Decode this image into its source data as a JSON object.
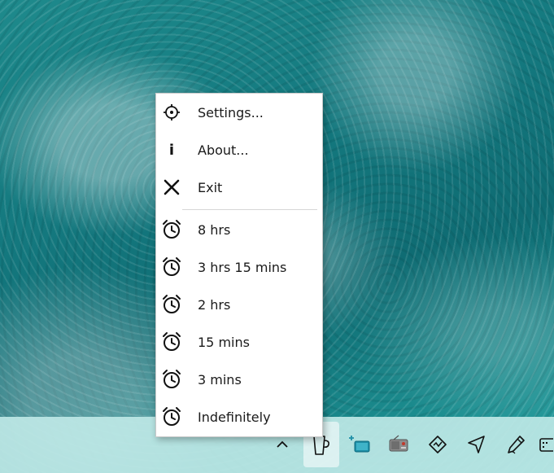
{
  "menu": {
    "items": [
      {
        "label": "Settings...",
        "icon": "gear-icon"
      },
      {
        "label": "About...",
        "icon": "info-icon"
      },
      {
        "label": "Exit",
        "icon": "close-icon"
      }
    ],
    "durations": [
      {
        "label": "8 hrs",
        "icon": "alarm-clock-icon"
      },
      {
        "label": "3 hrs 15 mins",
        "icon": "alarm-clock-icon"
      },
      {
        "label": "2 hrs",
        "icon": "alarm-clock-icon"
      },
      {
        "label": "15 mins",
        "icon": "alarm-clock-icon"
      },
      {
        "label": "3 mins",
        "icon": "alarm-clock-icon"
      },
      {
        "label": "Indefinitely",
        "icon": "alarm-clock-icon"
      }
    ]
  },
  "tray": {
    "icons": [
      "chevron-up-icon",
      "coffee-cup-icon",
      "screen-capture-icon",
      "radio-icon",
      "diamond-chart-icon",
      "send-arrow-icon",
      "pen-icon",
      "keyboard-icon"
    ]
  }
}
